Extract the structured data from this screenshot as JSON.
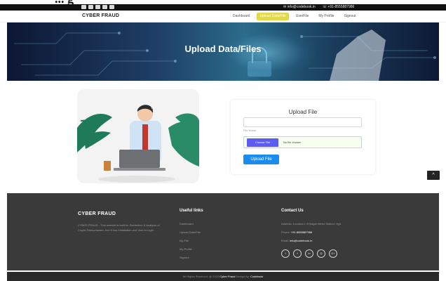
{
  "top_fragment": "... g",
  "topbar": {
    "social_icons": [
      "facebook-icon",
      "twitter-icon",
      "linkedin-icon",
      "instagram-icon",
      "google-plus-icon"
    ],
    "email": "✉ info@codebook.in",
    "phone": "☏ +91-8555887986"
  },
  "nav": {
    "brand": "CYBER FRAUD",
    "links": [
      "Dashboard",
      "Upload Data/File",
      "UserFile",
      "My Profile",
      "Signout"
    ],
    "active_index": 1
  },
  "hero": {
    "title": "Upload Data/Files"
  },
  "upload": {
    "title": "Upload File",
    "file_name_label": "File Name",
    "choose_button": "Choose File",
    "no_file_text": "No file chosen",
    "submit_label": "Upload File"
  },
  "scroll_top_glyph": "^",
  "footer": {
    "brand": "CYBER FRAUD",
    "description": "CYBER FRAUD - This website is built for Dectection & Analysis of Crypto Ransomware. And it has Installation and User to login.",
    "links_heading": "Useful links",
    "links": [
      "Dashboard",
      "Upload Data/File",
      "My File",
      "My Profile",
      "Signout"
    ],
    "contact_heading": "Contact Us",
    "address": "Address: Location L B Nagar Metro Station, Hyd.",
    "phone_label": "Phone: ",
    "phone": "+91-8555887986",
    "email_label": "Email: ",
    "email": "info@codebook.in",
    "social": [
      "f",
      "t",
      "in",
      "◎",
      "G+"
    ],
    "copyright_prefix": "All Rights Reserved. @ 2023 ",
    "copyright_brand": "Cyber Fraud",
    "copyright_mid": " Design By: ",
    "copyright_design": "Codebook"
  },
  "colors": {
    "accent": "#e0d94a",
    "primary_button": "#1a8cf0",
    "choose_button": "#5c5cf0",
    "footer_bg": "#3a3a3a"
  }
}
